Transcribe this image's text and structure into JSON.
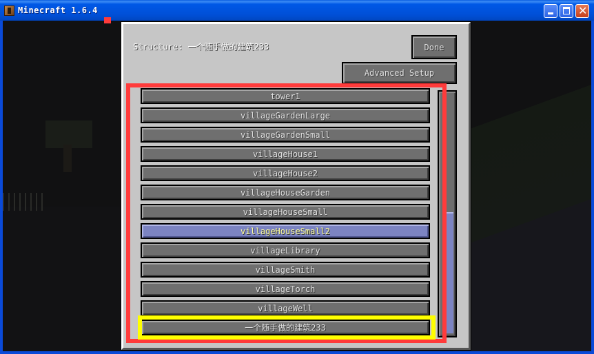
{
  "window": {
    "title": "Minecraft 1.6.4",
    "controls": [
      "minimize",
      "maximize",
      "close"
    ]
  },
  "dialog": {
    "structure_label": "Structure: 一个随手做的建筑233",
    "done_label": "Done",
    "advanced_setup_label": "Advanced Setup"
  },
  "list": {
    "items": [
      {
        "label": "tower1",
        "selected": false
      },
      {
        "label": "villageGardenLarge",
        "selected": false
      },
      {
        "label": "villageGardenSmall",
        "selected": false
      },
      {
        "label": "villageHouse1",
        "selected": false
      },
      {
        "label": "villageHouse2",
        "selected": false
      },
      {
        "label": "villageHouseGarden",
        "selected": false
      },
      {
        "label": "villageHouseSmall",
        "selected": false
      },
      {
        "label": "villageHouseSmall2",
        "selected": true
      },
      {
        "label": "villageLibrary",
        "selected": false
      },
      {
        "label": "villageSmith",
        "selected": false
      },
      {
        "label": "villageTorch",
        "selected": false
      },
      {
        "label": "villageWell",
        "selected": false
      },
      {
        "label": "一个随手做的建筑233",
        "selected": false
      }
    ],
    "selected_index": 7,
    "scroll_position": "bottom"
  },
  "colors": {
    "selection": "#7c84c2",
    "selected_text": "#ffffa0",
    "annotation_red": "#ff3b3b",
    "annotation_yellow": "#ffff00"
  }
}
